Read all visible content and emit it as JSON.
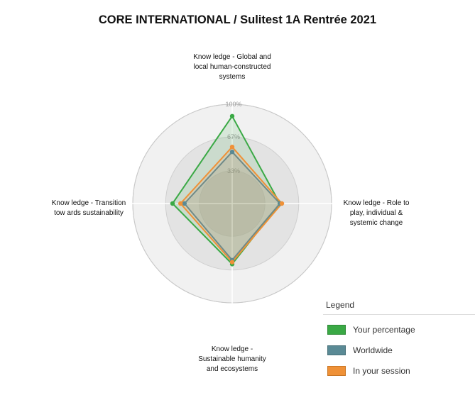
{
  "title": "CORE INTERNATIONAL / Sulitest 1A Rentrée 2021",
  "chart_data": {
    "type": "radar",
    "axes": [
      {
        "lines": [
          "Know ledge - Global and",
          "local human-constructed",
          "systems"
        ]
      },
      {
        "lines": [
          "Know ledge - Role to",
          "play, individual &",
          "systemic change"
        ]
      },
      {
        "lines": [
          "Know ledge -",
          "Sustainable humanity",
          "and ecosystems"
        ]
      },
      {
        "lines": [
          "Know ledge - Transition",
          "tow ards sustainability"
        ]
      }
    ],
    "ticks": [
      "33%",
      "67%",
      "100%"
    ],
    "tick_values": [
      33,
      67,
      100
    ],
    "range": [
      0,
      100
    ],
    "series": [
      {
        "name": "Your percentage",
        "color": "#3aa945",
        "values": [
          88,
          48,
          61,
          60
        ]
      },
      {
        "name": "Worldwide",
        "color": "#5a8a95",
        "values": [
          52,
          48,
          57,
          48
        ]
      },
      {
        "name": "In your session",
        "color": "#ef9137",
        "values": [
          57,
          50,
          59,
          52
        ]
      }
    ],
    "legend_title": "Legend",
    "legend_position": "bottom-right"
  }
}
